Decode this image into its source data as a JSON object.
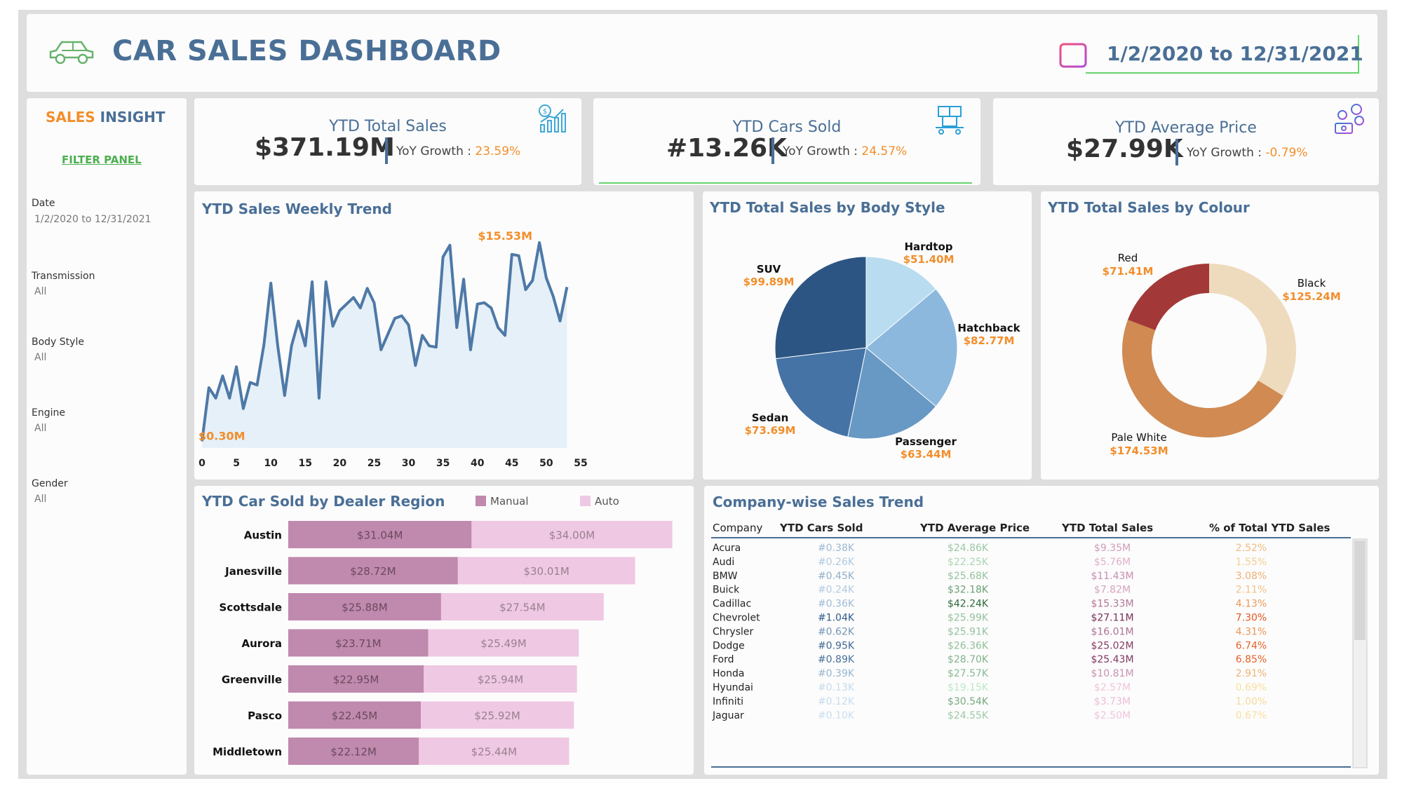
{
  "header": {
    "title": "CAR SALES DASHBOARD",
    "date_range": "1/2/2020 to 12/31/2021",
    "icons": [
      "car-icon",
      "calendar-icon"
    ]
  },
  "sidebar": {
    "title_part1": "SALES",
    "title_part2": "INSIGHT",
    "filter_panel": "FILTER PANEL",
    "filters": [
      {
        "label": "Date",
        "value": "1/2/2020 to 12/31/2021"
      },
      {
        "label": "Transmission",
        "value": "All"
      },
      {
        "label": "Body Style",
        "value": "All"
      },
      {
        "label": "Engine",
        "value": "All"
      },
      {
        "label": "Gender",
        "value": "All"
      }
    ]
  },
  "kpis": [
    {
      "title": "YTD Total Sales",
      "value": "$371.19M",
      "yoy_label": "YoY Growth : ",
      "yoy_value": "23.59%",
      "icon": "sales-growth-icon"
    },
    {
      "title": "YTD Cars Sold",
      "value": "#13.26K",
      "yoy_label": "YoY Growth : ",
      "yoy_value": "24.57%",
      "icon": "boxes-cart-icon"
    },
    {
      "title": "YTD Average Price",
      "value": "$27.99K",
      "yoy_label": "YoY Growth : ",
      "yoy_value": "-0.79%",
      "icon": "money-icon"
    }
  ],
  "colors": {
    "primary": "#4a6f96",
    "accent": "#f28e2b",
    "green": "#66d46f"
  },
  "chart_data": [
    {
      "type": "area",
      "title": "YTD Sales Weekly Trend",
      "x": [
        0,
        1,
        2,
        3,
        4,
        5,
        6,
        7,
        8,
        9,
        10,
        11,
        12,
        13,
        14,
        15,
        16,
        17,
        18,
        19,
        20,
        21,
        22,
        23,
        24,
        25,
        26,
        27,
        28,
        29,
        30,
        31,
        32,
        33,
        34,
        35,
        36,
        37,
        38,
        39,
        40,
        41,
        42,
        43,
        44,
        45,
        46,
        47,
        48,
        49,
        50,
        51,
        52,
        53
      ],
      "y": [
        0.3,
        4.4,
        3.6,
        5.3,
        3.6,
        6.0,
        2.8,
        4.8,
        4.6,
        7.7,
        12.4,
        7.6,
        3.8,
        7.6,
        9.5,
        7.6,
        12.5,
        3.6,
        12.5,
        9.1,
        10.3,
        10.8,
        11.3,
        10.5,
        12.0,
        10.9,
        7.3,
        8.5,
        9.7,
        9.9,
        9.2,
        6.1,
        8.4,
        7.6,
        7.5,
        14.4,
        15.3,
        9.0,
        12.7,
        7.3,
        10.8,
        10.9,
        10.5,
        9.0,
        8.4,
        14.6,
        14.5,
        11.9,
        12.6,
        15.5,
        12.8,
        11.4,
        9.5,
        12.1
      ],
      "annotations": [
        {
          "label": "$15.53M",
          "note": "max"
        },
        {
          "label": "$0.30M",
          "note": "min"
        }
      ],
      "xticks": [
        0,
        5,
        10,
        15,
        20,
        25,
        30,
        35,
        40,
        45,
        50,
        55
      ],
      "xlim": [
        0,
        55
      ]
    },
    {
      "type": "pie",
      "title": "YTD Total Sales by Body Style",
      "slices": [
        {
          "label": "Hardtop",
          "value": 51.4,
          "display": "$51.40M",
          "color": "#b9dcf0"
        },
        {
          "label": "Hatchback",
          "value": 82.77,
          "display": "$82.77M",
          "color": "#8cb8de"
        },
        {
          "label": "Passenger",
          "value": 63.44,
          "display": "$63.44M",
          "color": "#6899c4"
        },
        {
          "label": "Sedan",
          "value": 73.69,
          "display": "$73.69M",
          "color": "#4573a6"
        },
        {
          "label": "SUV",
          "value": 99.89,
          "display": "$99.89M",
          "color": "#2c5583"
        }
      ]
    },
    {
      "type": "pie",
      "subtype": "donut",
      "title": "YTD Total Sales by Colour",
      "slices": [
        {
          "label": "Black",
          "value": 125.24,
          "display": "$125.24M",
          "color": "#eedbbe"
        },
        {
          "label": "Pale White",
          "value": 174.53,
          "display": "$174.53M",
          "color": "#d08a52"
        },
        {
          "label": "Red",
          "value": 71.41,
          "display": "$71.41M",
          "color": "#a33838"
        }
      ]
    },
    {
      "type": "bar",
      "title": "YTD Car Sold by Dealer Region",
      "orientation": "horizontal",
      "stacked": true,
      "categories": [
        "Austin",
        "Janesville",
        "Scottsdale",
        "Aurora",
        "Greenville",
        "Pasco",
        "Middletown"
      ],
      "series": [
        {
          "name": "Manual",
          "color": "#c089ae",
          "values": [
            31.04,
            28.72,
            25.88,
            23.71,
            22.95,
            22.45,
            22.12
          ],
          "labels": [
            "$31.04M",
            "$28.72M",
            "$25.88M",
            "$23.71M",
            "$22.95M",
            "$22.45M",
            "$22.12M"
          ]
        },
        {
          "name": "Auto",
          "color": "#efc8e3",
          "values": [
            34.0,
            30.01,
            27.54,
            25.49,
            25.94,
            25.92,
            25.44
          ],
          "labels": [
            "$34.00M",
            "$30.01M",
            "$27.54M",
            "$25.49M",
            "$25.94M",
            "$25.92M",
            "$25.44M"
          ]
        }
      ]
    },
    {
      "type": "table",
      "title": "Company-wise Sales Trend",
      "columns": [
        "Company",
        "YTD Cars Sold",
        "YTD Average Price",
        "YTD Total Sales",
        "% of Total YTD Sales"
      ],
      "rows": [
        [
          "Acura",
          "#0.38K",
          "$24.86K",
          "$9.35M",
          "2.52%"
        ],
        [
          "Audi",
          "#0.26K",
          "$22.25K",
          "$5.76M",
          "1.55%"
        ],
        [
          "BMW",
          "#0.45K",
          "$25.68K",
          "$11.43M",
          "3.08%"
        ],
        [
          "Buick",
          "#0.24K",
          "$32.18K",
          "$7.82M",
          "2.11%"
        ],
        [
          "Cadillac",
          "#0.36K",
          "$42.24K",
          "$15.33M",
          "4.13%"
        ],
        [
          "Chevrolet",
          "#1.04K",
          "$25.99K",
          "$27.11M",
          "7.30%"
        ],
        [
          "Chrysler",
          "#0.62K",
          "$25.91K",
          "$16.01M",
          "4.31%"
        ],
        [
          "Dodge",
          "#0.95K",
          "$26.36K",
          "$25.02M",
          "6.74%"
        ],
        [
          "Ford",
          "#0.89K",
          "$28.70K",
          "$25.43M",
          "6.85%"
        ],
        [
          "Honda",
          "#0.39K",
          "$27.57K",
          "$10.81M",
          "2.91%"
        ],
        [
          "Hyundai",
          "#0.13K",
          "$19.15K",
          "$2.57M",
          "0.69%"
        ],
        [
          "Infiniti",
          "#0.12K",
          "$30.54K",
          "$3.73M",
          "1.00%"
        ],
        [
          "Jaguar",
          "#0.10K",
          "$24.55K",
          "$2.50M",
          "0.67%"
        ]
      ]
    }
  ]
}
